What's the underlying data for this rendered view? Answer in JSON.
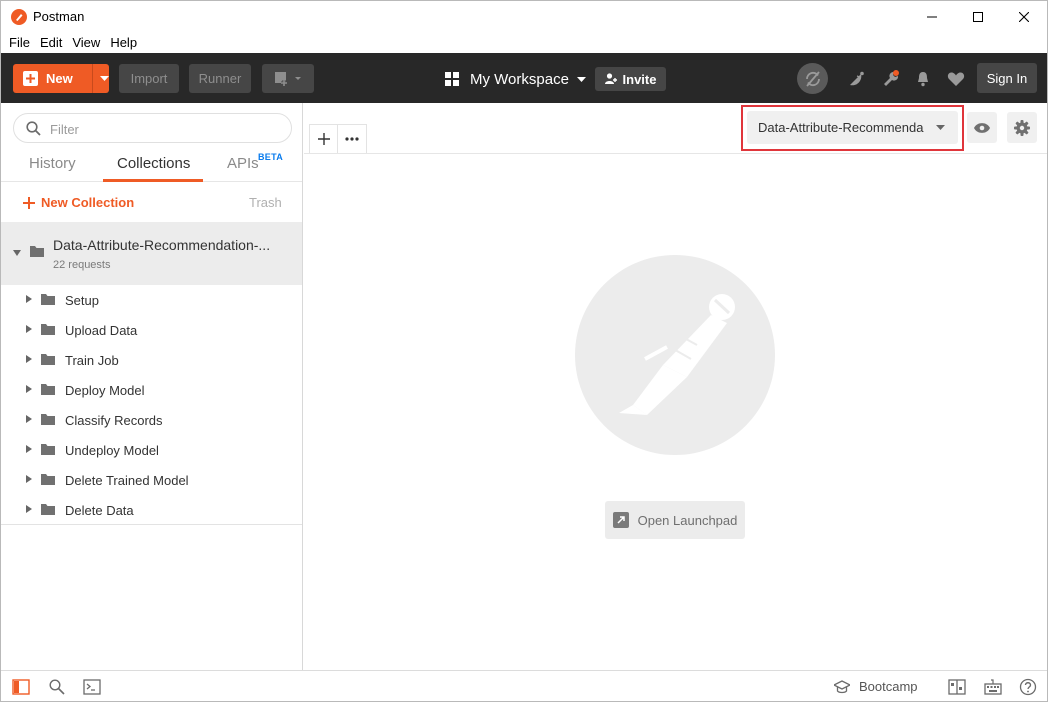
{
  "window": {
    "title": "Postman"
  },
  "menu": [
    "File",
    "Edit",
    "View",
    "Help"
  ],
  "header": {
    "new_label": "New",
    "import_label": "Import",
    "runner_label": "Runner",
    "workspace_label": "My Workspace",
    "invite_label": "Invite",
    "signin_label": "Sign In"
  },
  "sidebar": {
    "filter_placeholder": "Filter",
    "tabs": {
      "history": "History",
      "collections": "Collections",
      "apis": "APIs",
      "apis_badge": "BETA"
    },
    "new_collection_label": "New Collection",
    "trash_label": "Trash",
    "collection": {
      "name": "Data-Attribute-Recommendation-...",
      "meta": "22 requests"
    },
    "folders": [
      "Setup",
      "Upload Data",
      "Train Job",
      "Deploy Model",
      "Classify Records",
      "Undeploy Model",
      "Delete Trained Model",
      "Delete Data"
    ]
  },
  "main": {
    "environment_selected": "Data-Attribute-Recommenda",
    "launchpad_label": "Open Launchpad"
  },
  "statusbar": {
    "bootcamp_label": "Bootcamp"
  },
  "colors": {
    "accent": "#ef5b25",
    "header_bg": "#282828",
    "highlight": "#e0353b",
    "beta": "#097bed"
  }
}
